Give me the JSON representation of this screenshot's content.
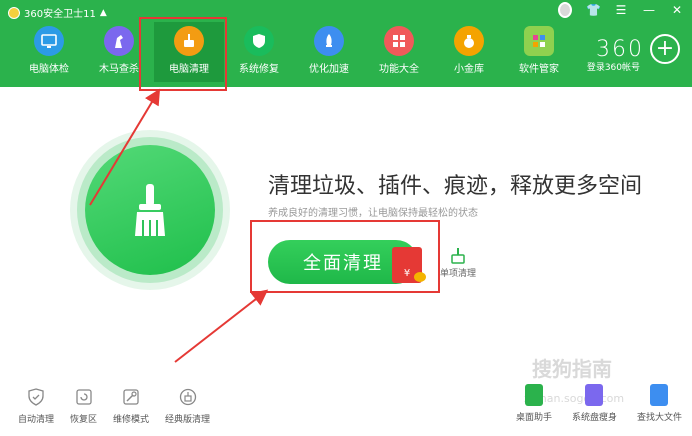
{
  "app": {
    "title": "360安全卫士11"
  },
  "nav": {
    "items": [
      {
        "label": "电脑体检",
        "color": "#2c9be6"
      },
      {
        "label": "木马查杀",
        "color": "#7b68ee"
      },
      {
        "label": "电脑清理",
        "color": "#f39c12"
      },
      {
        "label": "系统修复",
        "color": "#1abc5c"
      },
      {
        "label": "优化加速",
        "color": "#3d8ef0"
      },
      {
        "label": "功能大全",
        "color": "#f05a5a"
      },
      {
        "label": "小金库",
        "color": "#f4a300"
      },
      {
        "label": "软件管家",
        "color": "#8fd14f"
      }
    ]
  },
  "brand": {
    "logo_text": "360",
    "account": "登录360帐号"
  },
  "main": {
    "headline": "清理垃圾、插件、痕迹，释放更多空间",
    "subline": "养成良好的清理习惯，让电脑保持最轻松的状态",
    "clean_button": "全面清理",
    "redpacket_symbol": "¥",
    "single_clean": "单项清理"
  },
  "bottom_left": [
    {
      "label": "自动清理"
    },
    {
      "label": "恢复区"
    },
    {
      "label": "维修模式"
    },
    {
      "label": "经典版清理"
    }
  ],
  "bottom_right": [
    {
      "label": "桌面助手",
      "color": "#2bb24c"
    },
    {
      "label": "系统盘瘦身",
      "color": "#7b68ee"
    },
    {
      "label": "查找大文件",
      "color": "#3d8ef0"
    }
  ],
  "watermark": {
    "text": "搜狗指南",
    "url": "zhinan.sogou.com"
  },
  "colors": {
    "accent": "#2bb24c",
    "highlight": "#e53935"
  }
}
